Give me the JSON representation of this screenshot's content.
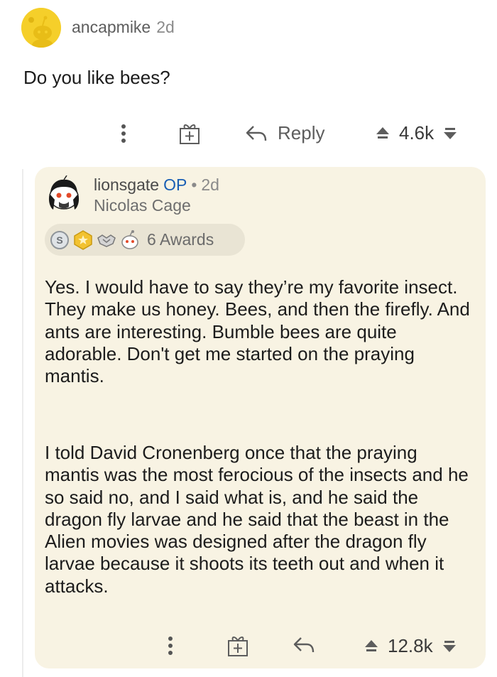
{
  "parent": {
    "username": "ancapmike",
    "time": "2d",
    "body": "Do you like bees?",
    "reply_label": "Reply",
    "vote_count": "4.6k"
  },
  "reply": {
    "username": "lionsgate",
    "op_tag": "OP",
    "separator": "•",
    "time": "2d",
    "flair": "Nicolas Cage",
    "awards_label": "6 Awards",
    "paragraph1": "Yes. I would have to say they’re my favorite insect. They make us honey. Bees, and then the firefly. And ants are interesting. Bumble bees are quite adorable. Don't get me started on the praying mantis.",
    "paragraph2": "I told David Cronenberg once that the praying mantis was the most ferocious of the insects and he so said no, and I said what is, and he said the dragon fly larvae and he said that the beast in the Alien movies was designed after the dragon fly larvae because it shoots its teeth out and when it attacks.",
    "vote_count": "12.8k"
  },
  "colors": {
    "card_bg": "#f8f3e3",
    "op_blue": "#1a5fb4",
    "avatar_yellow": "#f5cf2a"
  },
  "icons": [
    "more-icon",
    "gift-award-icon",
    "reply-arrow-icon",
    "upvote-icon",
    "downvote-icon",
    "snoo-avatar-icon"
  ]
}
